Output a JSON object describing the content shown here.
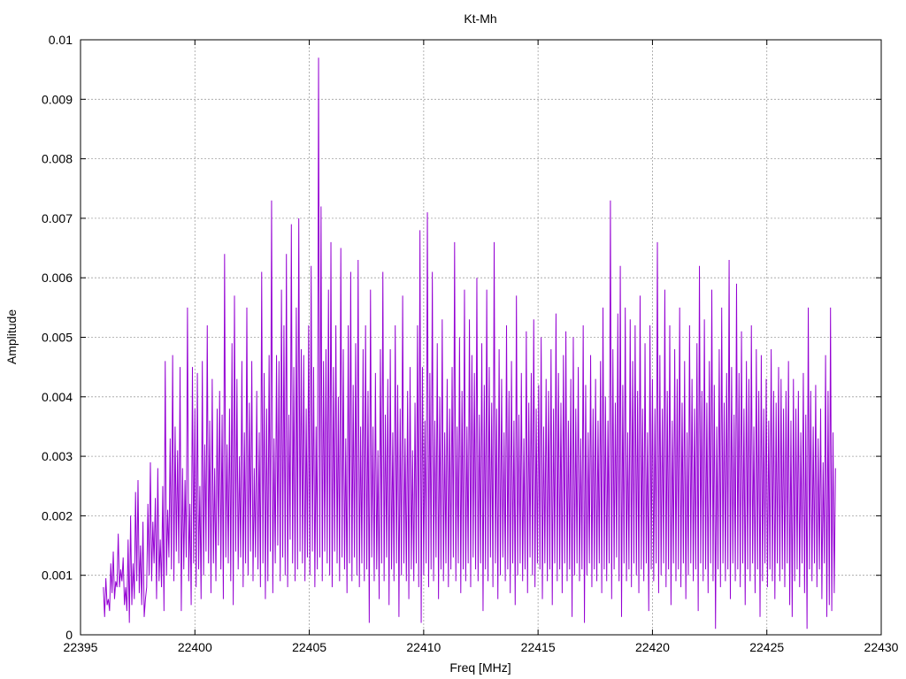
{
  "chart_data": {
    "type": "line",
    "title": "Kt-Mh",
    "xlabel": "Freq [MHz]",
    "ylabel": "Amplitude",
    "xlim": [
      22395,
      22430
    ],
    "ylim": [
      0,
      0.01
    ],
    "x_ticks": [
      "22395",
      "22400",
      "22405",
      "22410",
      "22415",
      "22420",
      "22425",
      "22430"
    ],
    "y_ticks": [
      "0",
      "0.001",
      "0.002",
      "0.003",
      "0.004",
      "0.005",
      "0.006",
      "0.007",
      "0.008",
      "0.009",
      "0.01"
    ],
    "grid": true,
    "line_color": "#9400d3",
    "series": [
      {
        "x_start": 22396.0,
        "x_end": 22428.0,
        "values": [
          0.0008,
          0.00095,
          0.0006,
          0.0012,
          0.0014,
          0.0009,
          0.0017,
          0.0011,
          0.0013,
          0.0008,
          0.0016,
          0.002,
          0.0012,
          0.0024,
          0.0026,
          0.0015,
          0.0019,
          0.0006,
          0.0022,
          0.0029,
          0.0019,
          0.0023,
          0.0028,
          0.0016,
          0.0025,
          0.0046,
          0.0021,
          0.0033,
          0.0047,
          0.0035,
          0.0031,
          0.0045,
          0.0028,
          0.0026,
          0.0055,
          0.0022,
          0.0045,
          0.0038,
          0.0044,
          0.0025,
          0.0046,
          0.0032,
          0.0052,
          0.0036,
          0.0043,
          0.0028,
          0.0038,
          0.0041,
          0.0037,
          0.0064,
          0.0032,
          0.0038,
          0.0049,
          0.0057,
          0.0043,
          0.003,
          0.0046,
          0.0034,
          0.0055,
          0.0039,
          0.0046,
          0.0028,
          0.0041,
          0.0034,
          0.0061,
          0.0044,
          0.0038,
          0.0047,
          0.0073,
          0.0033,
          0.0047,
          0.0046,
          0.0058,
          0.0052,
          0.0064,
          0.0037,
          0.0069,
          0.0045,
          0.0055,
          0.007,
          0.0048,
          0.0047,
          0.0038,
          0.0052,
          0.0062,
          0.0045,
          0.0035,
          0.0097,
          0.0072,
          0.0046,
          0.0048,
          0.0058,
          0.0066,
          0.0045,
          0.0052,
          0.004,
          0.0065,
          0.0048,
          0.0033,
          0.0052,
          0.0061,
          0.0042,
          0.0049,
          0.0063,
          0.0035,
          0.0048,
          0.0052,
          0.0041,
          0.0058,
          0.0035,
          0.0044,
          0.0031,
          0.0048,
          0.0061,
          0.0037,
          0.0043,
          0.0048,
          0.0034,
          0.0052,
          0.0042,
          0.0038,
          0.0057,
          0.0033,
          0.0041,
          0.0045,
          0.0031,
          0.0039,
          0.0052,
          0.0068,
          0.0045,
          0.0036,
          0.0071,
          0.0044,
          0.0061,
          0.0036,
          0.0049,
          0.004,
          0.0053,
          0.0034,
          0.0043,
          0.0038,
          0.0045,
          0.0066,
          0.0035,
          0.005,
          0.0041,
          0.0058,
          0.0035,
          0.0053,
          0.0047,
          0.0044,
          0.006,
          0.0037,
          0.0049,
          0.0042,
          0.0058,
          0.0045,
          0.0039,
          0.0066,
          0.0038,
          0.0048,
          0.0043,
          0.0034,
          0.0052,
          0.0041,
          0.0046,
          0.0036,
          0.0057,
          0.0037,
          0.0044,
          0.0033,
          0.0051,
          0.0039,
          0.0044,
          0.0053,
          0.0038,
          0.0042,
          0.005,
          0.0035,
          0.0043,
          0.0041,
          0.0048,
          0.0038,
          0.0054,
          0.0044,
          0.0039,
          0.0047,
          0.0051,
          0.0036,
          0.0043,
          0.005,
          0.0038,
          0.0045,
          0.0033,
          0.0052,
          0.0042,
          0.0034,
          0.0047,
          0.0038,
          0.0043,
          0.0036,
          0.0046,
          0.0055,
          0.004,
          0.0036,
          0.0073,
          0.0048,
          0.0039,
          0.0054,
          0.0062,
          0.0042,
          0.0055,
          0.0034,
          0.0053,
          0.0046,
          0.0052,
          0.0041,
          0.0057,
          0.0038,
          0.0049,
          0.0034,
          0.0052,
          0.0043,
          0.0038,
          0.0066,
          0.0047,
          0.0038,
          0.0058,
          0.0041,
          0.0052,
          0.0036,
          0.0048,
          0.0043,
          0.0055,
          0.0039,
          0.0046,
          0.0034,
          0.0052,
          0.0043,
          0.0038,
          0.0049,
          0.0062,
          0.0041,
          0.0053,
          0.0039,
          0.0046,
          0.0058,
          0.0042,
          0.0035,
          0.0048,
          0.0055,
          0.0039,
          0.0044,
          0.0063,
          0.0045,
          0.0037,
          0.0059,
          0.0044,
          0.0051,
          0.0038,
          0.0046,
          0.0043,
          0.0052,
          0.0035,
          0.0048,
          0.0041,
          0.0047,
          0.0038,
          0.0043,
          0.0036,
          0.0048,
          0.0041,
          0.0039,
          0.0045,
          0.0043,
          0.0038,
          0.0041,
          0.0046,
          0.0036,
          0.0043,
          0.0038,
          0.0041,
          0.0034,
          0.0044,
          0.0037,
          0.0055,
          0.0041,
          0.0035,
          0.0042,
          0.0033,
          0.0038,
          0.0029,
          0.0047,
          0.0041,
          0.0055,
          0.0034,
          0.0028
        ]
      }
    ],
    "min_values": [
      0.0003,
      0.0005,
      0.0004,
      0.0007,
      0.0006,
      0.0008,
      0.0008,
      0.0009,
      0.0005,
      0.0004,
      0.0002,
      0.0005,
      0.0006,
      0.0009,
      0.0007,
      0.0005,
      0.0003,
      0.0008,
      0.001,
      0.0009,
      0.0012,
      0.0006,
      0.0009,
      0.0008,
      0.0004,
      0.001,
      0.0013,
      0.0011,
      0.0009,
      0.0014,
      0.0012,
      0.0004,
      0.0011,
      0.0013,
      0.0009,
      0.0005,
      0.0012,
      0.0008,
      0.0011,
      0.0006,
      0.001,
      0.0014,
      0.0012,
      0.0007,
      0.0012,
      0.0009,
      0.0015,
      0.0011,
      0.0006,
      0.0013,
      0.0012,
      0.0009,
      0.0005,
      0.0014,
      0.0011,
      0.0013,
      0.0008,
      0.0012,
      0.001,
      0.0014,
      0.0009,
      0.0013,
      0.0011,
      0.0008,
      0.0012,
      0.0006,
      0.0009,
      0.0014,
      0.0007,
      0.0012,
      0.0015,
      0.0009,
      0.0013,
      0.001,
      0.0008,
      0.0016,
      0.0012,
      0.0009,
      0.0011,
      0.0014,
      0.0012,
      0.0009,
      0.0013,
      0.001,
      0.0014,
      0.0008,
      0.0011,
      0.0013,
      0.0009,
      0.0014,
      0.0012,
      0.001,
      0.0008,
      0.0014,
      0.0012,
      0.0009,
      0.0013,
      0.0011,
      0.0007,
      0.0012,
      0.0009,
      0.0013,
      0.001,
      0.0008,
      0.0012,
      0.0009,
      0.0011,
      0.0002,
      0.0013,
      0.0009,
      0.0011,
      0.0006,
      0.0012,
      0.0009,
      0.0013,
      0.0005,
      0.0011,
      0.0009,
      0.0012,
      0.0003,
      0.001,
      0.0012,
      0.0009,
      0.0006,
      0.0011,
      0.0009,
      0.0012,
      0.0008,
      0.0002,
      0.001,
      0.0012,
      0.0008,
      0.0011,
      0.0009,
      0.0013,
      0.0006,
      0.0011,
      0.0009,
      0.0012,
      0.0008,
      0.0011,
      0.0013,
      0.0009,
      0.0012,
      0.0007,
      0.0011,
      0.0009,
      0.0012,
      0.0008,
      0.0013,
      0.0011,
      0.0009,
      0.0012,
      0.0004,
      0.0011,
      0.0009,
      0.0013,
      0.0008,
      0.0012,
      0.0006,
      0.001,
      0.0013,
      0.0009,
      0.0011,
      0.0007,
      0.0012,
      0.0005,
      0.001,
      0.0012,
      0.0009,
      0.0011,
      0.0007,
      0.0013,
      0.001,
      0.0008,
      0.0012,
      0.0011,
      0.0006,
      0.0012,
      0.0009,
      0.0011,
      0.0005,
      0.0012,
      0.0009,
      0.0011,
      0.0007,
      0.0012,
      0.0009,
      0.0011,
      0.0003,
      0.001,
      0.0012,
      0.0009,
      0.0011,
      0.0002,
      0.001,
      0.0012,
      0.0008,
      0.0011,
      0.0009,
      0.0012,
      0.0007,
      0.0011,
      0.0009,
      0.0012,
      0.0006,
      0.0011,
      0.0013,
      0.0009,
      0.0003,
      0.0012,
      0.0009,
      0.0011,
      0.0008,
      0.0012,
      0.001,
      0.0007,
      0.0011,
      0.0009,
      0.0012,
      0.0004,
      0.0011,
      0.0009,
      0.0012,
      0.0007,
      0.001,
      0.0012,
      0.0008,
      0.0011,
      0.0005,
      0.0012,
      0.0009,
      0.0011,
      0.0008,
      0.0012,
      0.0006,
      0.001,
      0.0012,
      0.0009,
      0.0011,
      0.0004,
      0.0012,
      0.0009,
      0.0011,
      0.0007,
      0.0012,
      0.0009,
      0.0001,
      0.0011,
      0.0008,
      0.0012,
      0.0009,
      0.0011,
      0.0006,
      0.0012,
      0.0009,
      0.0011,
      0.0008,
      0.0012,
      0.0005,
      0.0011,
      0.0009,
      0.0012,
      0.0007,
      0.0011,
      0.0003,
      0.0009,
      0.0012,
      0.0008,
      0.0011,
      0.0009,
      0.0006,
      0.0012,
      0.0009,
      0.0011,
      0.0008,
      0.0012,
      0.0005,
      0.0003,
      0.0009,
      0.0011,
      0.0008,
      0.0012,
      0.0007,
      0.0001,
      0.0011,
      0.0009,
      0.0012,
      0.0008,
      0.0011,
      0.0006,
      0.0012
    ]
  }
}
